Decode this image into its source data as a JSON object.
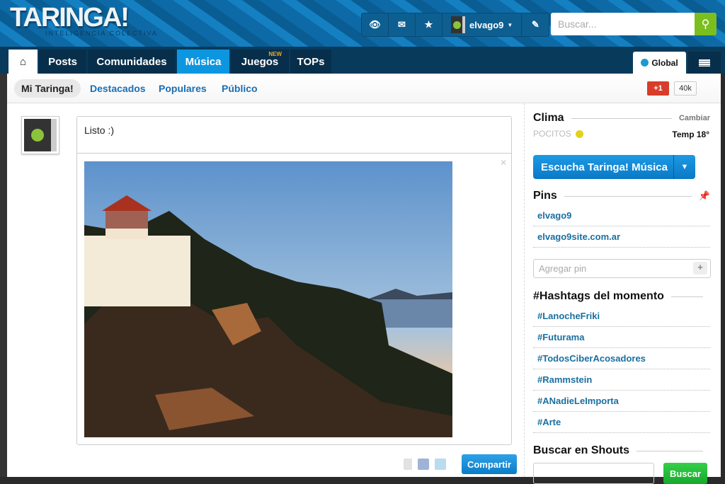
{
  "header": {
    "logo": "TARINGA!",
    "tagline": "INTELIGENCIA COLECTIVA",
    "username": "elvago9",
    "search_placeholder": "Buscar..."
  },
  "nav": {
    "tabs": [
      "Posts",
      "Comunidades",
      "Música",
      "Juegos",
      "TOPs"
    ],
    "new_badge": "NEW",
    "global": "Global"
  },
  "subnav": {
    "items": [
      "Mi Taringa!",
      "Destacados",
      "Populares",
      "Público"
    ],
    "gplus": "+1",
    "gcount": "40k"
  },
  "composer": {
    "status": "Listo :)",
    "share": "Compartir"
  },
  "sidebar": {
    "clima": {
      "title": "Clima",
      "change": "Cambiar",
      "city": "POCITOS",
      "temp": "Temp 18°"
    },
    "music_button": "Escucha Taringa! Música",
    "pins": {
      "title": "Pins",
      "items": [
        "elvago9",
        "elvago9site.com.ar"
      ],
      "add_placeholder": "Agregar pin"
    },
    "hashtags": {
      "title": "#Hashtags del momento",
      "items": [
        "#LanocheFriki",
        "#Futurama",
        "#TodosCiberAcosadores",
        "#Rammstein",
        "#ANadieLeImporta",
        "#Arte"
      ]
    },
    "shouts": {
      "title": "Buscar en Shouts",
      "button": "Buscar"
    }
  }
}
